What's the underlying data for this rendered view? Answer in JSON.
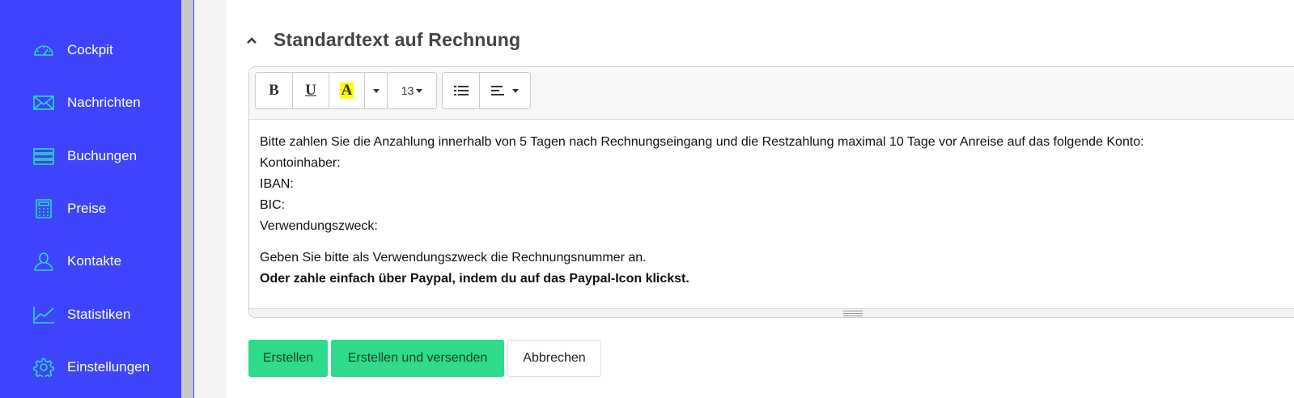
{
  "sidebar": {
    "items": [
      {
        "label": "Cockpit",
        "icon": "speedometer-icon"
      },
      {
        "label": "Nachrichten",
        "icon": "envelope-icon"
      },
      {
        "label": "Buchungen",
        "icon": "list-icon"
      },
      {
        "label": "Preise",
        "icon": "calculator-icon"
      },
      {
        "label": "Kontakte",
        "icon": "user-icon"
      },
      {
        "label": "Statistiken",
        "icon": "line-chart-icon"
      },
      {
        "label": "Einstellungen",
        "icon": "gear-icon"
      }
    ],
    "background": "#3d44fb",
    "icon_color": "#2ddbb8"
  },
  "section": {
    "title": "Standardtext auf Rechnung"
  },
  "toolbar": {
    "bold": "B",
    "underline": "U",
    "highlight": "A",
    "font_size": "13",
    "highlight_color": "#ffff00"
  },
  "editor": {
    "lines": [
      "Bitte zahlen Sie die Anzahlung innerhalb von 5 Tagen nach Rechnungseingang und die Restzahlung maximal 10 Tage vor Anreise auf das folgende Konto:",
      "Kontoinhaber:",
      "IBAN:",
      "BIC:",
      "Verwendungszweck:"
    ],
    "paragraph2": "Geben Sie bitte als Verwendungszweck die Rechnungsnummer an.",
    "paragraph3_bold": "Oder zahle einfach über Paypal, indem du auf das Paypal-Icon klickst."
  },
  "actions": {
    "create": "Erstellen",
    "create_send": "Erstellen und versenden",
    "cancel": "Abbrechen",
    "accent": "#2ddb8a"
  }
}
